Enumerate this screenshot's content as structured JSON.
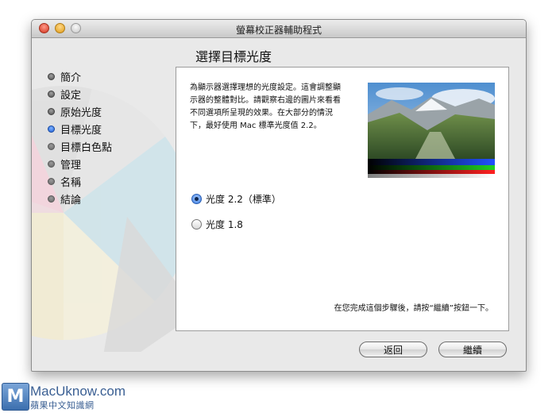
{
  "window": {
    "title": "螢幕校正器輔助程式"
  },
  "page": {
    "heading": "選擇目標光度"
  },
  "steps": [
    {
      "label": "簡介",
      "state": "done"
    },
    {
      "label": "設定",
      "state": "done"
    },
    {
      "label": "原始光度",
      "state": "done"
    },
    {
      "label": "目標光度",
      "state": "current"
    },
    {
      "label": "目標白色點",
      "state": "todo"
    },
    {
      "label": "管理",
      "state": "todo"
    },
    {
      "label": "名稱",
      "state": "todo"
    },
    {
      "label": "結論",
      "state": "todo"
    }
  ],
  "panel": {
    "description_lines": [
      "為顯示器選擇理想的光度設定。這會調整顯",
      "示器的整體對比。請觀察右邊的圖片來看看",
      "不同選項所呈現的效果。在大部分的情況",
      "下，最好使用 Mac 標準光度值 2.2。"
    ],
    "options": [
      {
        "label": "光度 2.2（標準）",
        "selected": true
      },
      {
        "label": "光度 1.8",
        "selected": false
      }
    ],
    "hint": "在您完成這個步驟後，請按“繼續”按鈕一下。"
  },
  "buttons": {
    "back": "返回",
    "continue": "繼續"
  },
  "watermark": {
    "logo_letter": "M",
    "name": "MacUknow.com",
    "subtitle": "蘋果中文知識網"
  },
  "colors": {
    "accent": "#1c5ed6",
    "wheel_pink": "#f3d3dc",
    "wheel_cyan": "#cfe4ea",
    "wheel_yellow": "#f2ecd2"
  }
}
